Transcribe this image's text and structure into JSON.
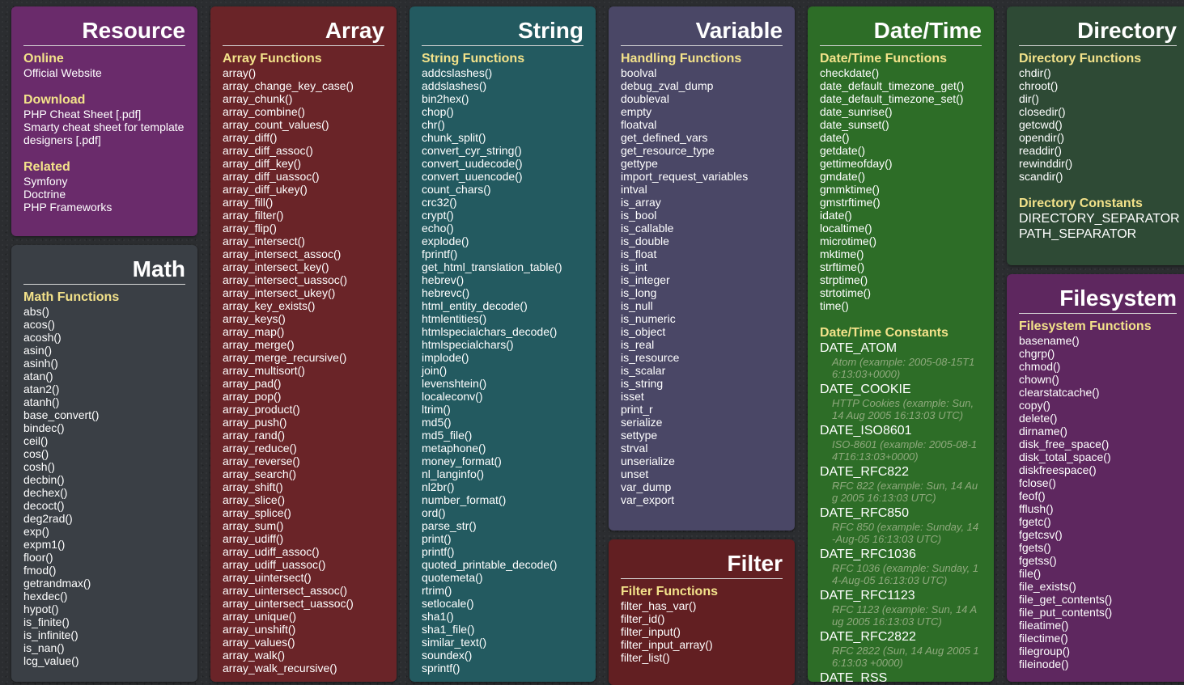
{
  "cards": {
    "resource": {
      "title": "Resource",
      "sections": [
        {
          "heading": "Online",
          "items": [
            "Official Website"
          ]
        },
        {
          "heading": "Download",
          "items": [
            "PHP Cheat Sheet [.pdf]",
            "Smarty cheat sheet for template",
            "designers [.pdf]"
          ]
        },
        {
          "heading": "Related",
          "items": [
            "Symfony",
            "Doctrine",
            "PHP Frameworks"
          ]
        }
      ]
    },
    "math": {
      "title": "Math",
      "heading": "Math Functions",
      "items": [
        "abs()",
        "acos()",
        "acosh()",
        "asin()",
        "asinh()",
        "atan()",
        "atan2()",
        "atanh()",
        "base_convert()",
        "bindec()",
        "ceil()",
        "cos()",
        "cosh()",
        "decbin()",
        "dechex()",
        "decoct()",
        "deg2rad()",
        "exp()",
        "expm1()",
        "floor()",
        "fmod()",
        "getrandmax()",
        "hexdec()",
        "hypot()",
        "is_finite()",
        "is_infinite()",
        "is_nan()",
        "lcg_value()"
      ]
    },
    "array": {
      "title": "Array",
      "heading": "Array Functions",
      "items": [
        "array()",
        "array_change_key_case()",
        "array_chunk()",
        "array_combine()",
        "array_count_values()",
        "array_diff()",
        "array_diff_assoc()",
        "array_diff_key()",
        "array_diff_uassoc()",
        "array_diff_ukey()",
        "array_fill()",
        "array_filter()",
        "array_flip()",
        "array_intersect()",
        "array_intersect_assoc()",
        "array_intersect_key()",
        "array_intersect_uassoc()",
        "array_intersect_ukey()",
        "array_key_exists()",
        "array_keys()",
        "array_map()",
        "array_merge()",
        "array_merge_recursive()",
        "array_multisort()",
        "array_pad()",
        "array_pop()",
        "array_product()",
        "array_push()",
        "array_rand()",
        "array_reduce()",
        "array_reverse()",
        "array_search()",
        "array_shift()",
        "array_slice()",
        "array_splice()",
        "array_sum()",
        "array_udiff()",
        "array_udiff_assoc()",
        "array_udiff_uassoc()",
        "array_uintersect()",
        "array_uintersect_assoc()",
        "array_uintersect_uassoc()",
        "array_unique()",
        "array_unshift()",
        "array_values()",
        "array_walk()",
        "array_walk_recursive()"
      ]
    },
    "string": {
      "title": "String",
      "heading": "String Functions",
      "items": [
        "addcslashes()",
        "addslashes()",
        "bin2hex()",
        "chop()",
        "chr()",
        "chunk_split()",
        "convert_cyr_string()",
        "convert_uudecode()",
        "convert_uuencode()",
        "count_chars()",
        "crc32()",
        "crypt()",
        "echo()",
        "explode()",
        "fprintf()",
        "get_html_translation_table()",
        "hebrev()",
        "hebrevc()",
        "html_entity_decode()",
        "htmlentities()",
        "htmlspecialchars_decode()",
        "htmlspecialchars()",
        "implode()",
        "join()",
        "levenshtein()",
        "localeconv()",
        "ltrim()",
        "md5()",
        "md5_file()",
        "metaphone()",
        "money_format()",
        "nl_langinfo()",
        "nl2br()",
        "number_format()",
        "ord()",
        "parse_str()",
        "print()",
        "printf()",
        "quoted_printable_decode()",
        "quotemeta()",
        "rtrim()",
        "setlocale()",
        "sha1()",
        "sha1_file()",
        "similar_text()",
        "soundex()",
        "sprintf()"
      ]
    },
    "variable": {
      "title": "Variable",
      "heading": "Handling Functions",
      "items": [
        "boolval",
        "debug_zval_dump",
        "doubleval",
        "empty",
        "floatval",
        "get_defined_vars",
        "get_resource_type",
        "gettype",
        "import_request_variables",
        "intval",
        "is_array",
        "is_bool",
        "is_callable",
        "is_double",
        "is_float",
        "is_int",
        "is_integer",
        "is_long",
        "is_null",
        "is_numeric",
        "is_object",
        "is_real",
        "is_resource",
        "is_scalar",
        "is_string",
        "isset",
        "print_r",
        "serialize",
        "settype",
        "strval",
        "unserialize",
        "unset",
        "var_dump",
        "var_export"
      ]
    },
    "filter": {
      "title": "Filter",
      "heading": "Filter Functions",
      "items": [
        "filter_has_var()",
        "filter_id()",
        "filter_input()",
        "filter_input_array()",
        "filter_list()"
      ]
    },
    "datetime": {
      "title": "Date/Time",
      "heading": "Date/Time Functions",
      "items": [
        "checkdate()",
        "date_default_timezone_get()",
        "date_default_timezone_set()",
        "date_sunrise()",
        "date_sunset()",
        "date()",
        "getdate()",
        "gettimeofday()",
        "gmdate()",
        "gmmktime()",
        "gmstrftime()",
        "idate()",
        "localtime()",
        "microtime()",
        "mktime()",
        "strftime()",
        "strptime()",
        "strtotime()",
        "time()"
      ],
      "const_heading": "Date/Time Constants",
      "constants": [
        {
          "name": "DATE_ATOM",
          "note": "Atom (example: 2005-08-15T1 6:13:03+0000)"
        },
        {
          "name": "DATE_COOKIE",
          "note": "HTTP Cookies (example: Sun, 14 Aug 2005 16:13:03 UTC)"
        },
        {
          "name": "DATE_ISO8601",
          "note": "ISO-8601 (example: 2005-08-1 4T16:13:03+0000)"
        },
        {
          "name": "DATE_RFC822",
          "note": "RFC 822 (example: Sun, 14 Au g 2005 16:13:03 UTC)"
        },
        {
          "name": "DATE_RFC850",
          "note": "RFC 850 (example: Sunday, 14 -Aug-05 16:13:03 UTC)"
        },
        {
          "name": "DATE_RFC1036",
          "note": "RFC 1036 (example: Sunday, 1 4-Aug-05 16:13:03 UTC)"
        },
        {
          "name": "DATE_RFC1123",
          "note": "RFC 1123 (example: Sun, 14 A ug 2005 16:13:03 UTC)"
        },
        {
          "name": "DATE_RFC2822",
          "note": "RFC 2822 (Sun, 14 Aug 2005 1 6:13:03 +0000)"
        },
        {
          "name": "DATE_RSS",
          "note": ""
        }
      ]
    },
    "directory": {
      "title": "Directory",
      "heading": "Directory Functions",
      "items": [
        "chdir()",
        "chroot()",
        "dir()",
        "closedir()",
        "getcwd()",
        "opendir()",
        "readdir()",
        "rewinddir()",
        "scandir()"
      ],
      "const_heading": "Directory Constants",
      "constants": [
        "DIRECTORY_SEPARATOR",
        "PATH_SEPARATOR"
      ]
    },
    "filesystem": {
      "title": "Filesystem",
      "heading": "Filesystem Functions",
      "items": [
        "basename()",
        "chgrp()",
        "chmod()",
        "chown()",
        "clearstatcache()",
        "copy()",
        "delete()",
        "dirname()",
        "disk_free_space()",
        "disk_total_space()",
        "diskfreespace()",
        "fclose()",
        "feof()",
        "fflush()",
        "fgetc()",
        "fgetcsv()",
        "fgets()",
        "fgetss()",
        "file()",
        "file_exists()",
        "file_get_contents()",
        "file_put_contents()",
        "fileatime()",
        "filectime()",
        "filegroup()",
        "fileinode()"
      ]
    }
  }
}
